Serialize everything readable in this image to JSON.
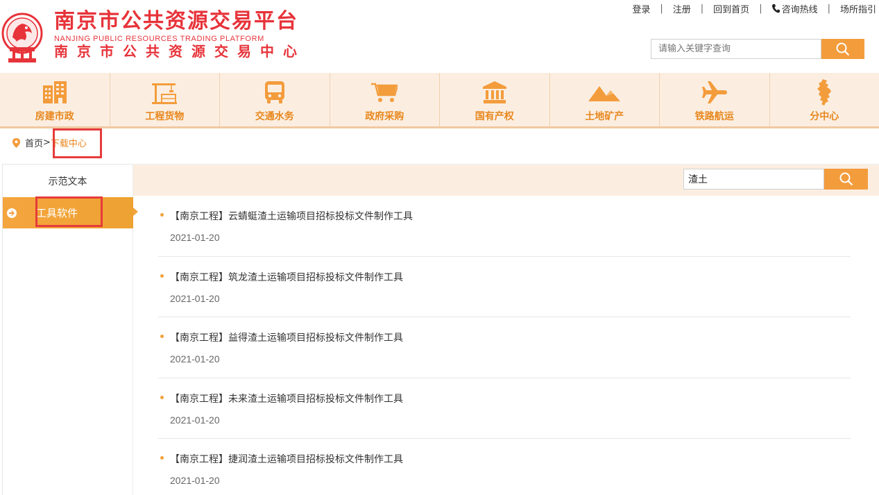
{
  "header": {
    "title": "南京市公共资源交易平台",
    "title_en": "NANJING PUBLIC RESOURCES TRADING PLATFORM",
    "subtitle": "南京市公共资源交易中心",
    "brand_color": "#e7333a"
  },
  "toplinks": {
    "login": "登录",
    "register": "注册",
    "home": "回到首页",
    "hotline": "咨询热线",
    "guide": "场所指引",
    "separator": "|"
  },
  "top_search": {
    "placeholder": "请输入关键字查询"
  },
  "nav": {
    "items": [
      {
        "label": "房建市政",
        "icon": "building-icon"
      },
      {
        "label": "工程货物",
        "icon": "crane-icon"
      },
      {
        "label": "交通水务",
        "icon": "bus-icon"
      },
      {
        "label": "政府采购",
        "icon": "cart-icon"
      },
      {
        "label": "国有产权",
        "icon": "bank-icon"
      },
      {
        "label": "土地矿产",
        "icon": "mountain-icon"
      },
      {
        "label": "铁路航运",
        "icon": "airplane-icon"
      },
      {
        "label": "分中心",
        "icon": "map-icon"
      }
    ],
    "accent": "#e8871e"
  },
  "breadcrumb": {
    "home": "首页",
    "separator": ">",
    "current": "下载中心"
  },
  "sidebar": {
    "items": [
      {
        "label": "示范文本"
      },
      {
        "label": "工具软件"
      }
    ]
  },
  "list_search": {
    "value": "渣土"
  },
  "list": {
    "items": [
      {
        "title": "【南京工程】云蜻蜓渣土运输项目招标投标文件制作工具",
        "date": "2021-01-20"
      },
      {
        "title": "【南京工程】筑龙渣土运输项目招标投标文件制作工具",
        "date": "2021-01-20"
      },
      {
        "title": "【南京工程】益得渣土运输项目招标投标文件制作工具",
        "date": "2021-01-20"
      },
      {
        "title": "【南京工程】未来渣土运输项目招标投标文件制作工具",
        "date": "2021-01-20"
      },
      {
        "title": "【南京工程】捷润渣土运输项目招标投标文件制作工具",
        "date": "2021-01-20"
      }
    ]
  }
}
